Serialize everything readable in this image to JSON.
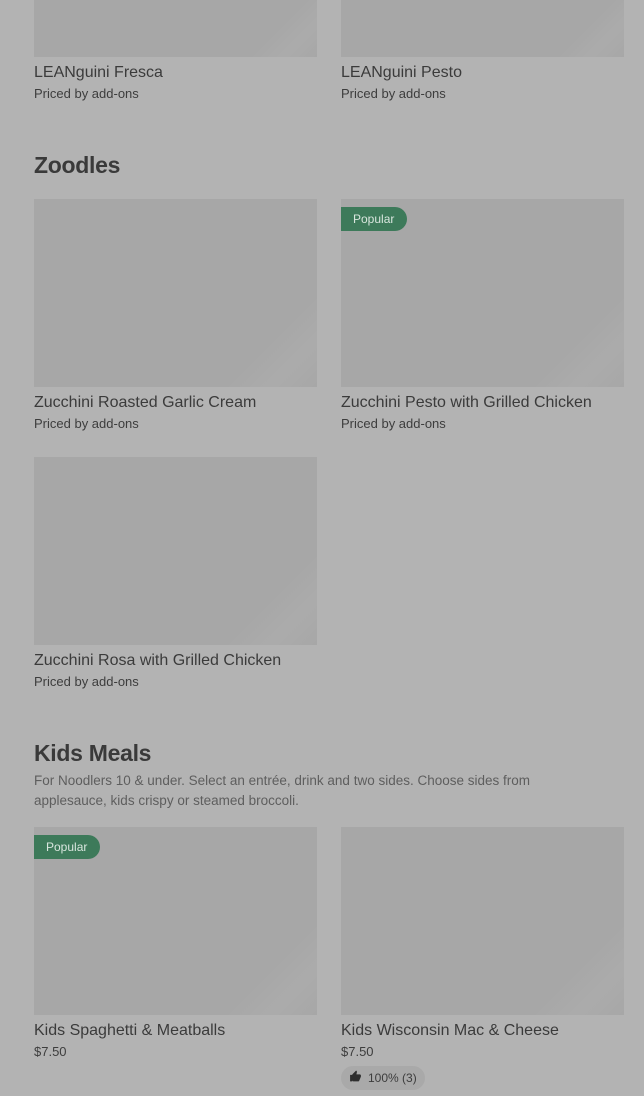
{
  "top_items": [
    {
      "name": "LEANguini Fresca",
      "price": "Priced by add-ons"
    },
    {
      "name": "LEANguini Pesto",
      "price": "Priced by add-ons"
    }
  ],
  "zoodles": {
    "title": "Zoodles",
    "items": [
      {
        "name": "Zucchini Roasted Garlic Cream",
        "price": "Priced by add-ons",
        "badge": ""
      },
      {
        "name": "Zucchini Pesto with Grilled Chicken",
        "price": "Priced by add-ons",
        "badge": "Popular"
      },
      {
        "name": "Zucchini Rosa with Grilled Chicken",
        "price": "Priced by add-ons",
        "badge": ""
      }
    ]
  },
  "kids": {
    "title": "Kids Meals",
    "description": "For Noodlers 10 & under. Select an entrée, drink and two sides. Choose sides from applesauce, kids crispy or steamed broccoli.",
    "items": [
      {
        "name": "Kids Spaghetti & Meatballs",
        "price": "$7.50",
        "badge": "Popular"
      },
      {
        "name": "Kids Wisconsin Mac & Cheese",
        "price": "$7.50",
        "badge": "",
        "rating": "100% (3)"
      }
    ]
  },
  "icons": {
    "rating": "thumbs-up-icon"
  }
}
